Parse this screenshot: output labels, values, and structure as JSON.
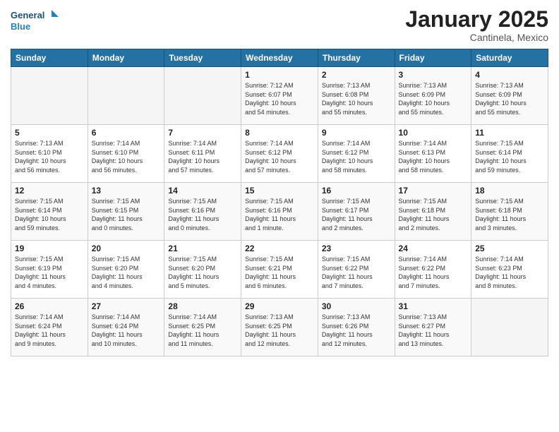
{
  "logo": {
    "line1": "General",
    "line2": "Blue"
  },
  "title": "January 2025",
  "subtitle": "Cantinela, Mexico",
  "weekdays": [
    "Sunday",
    "Monday",
    "Tuesday",
    "Wednesday",
    "Thursday",
    "Friday",
    "Saturday"
  ],
  "weeks": [
    [
      {
        "day": "",
        "info": ""
      },
      {
        "day": "",
        "info": ""
      },
      {
        "day": "",
        "info": ""
      },
      {
        "day": "1",
        "info": "Sunrise: 7:12 AM\nSunset: 6:07 PM\nDaylight: 10 hours\nand 54 minutes."
      },
      {
        "day": "2",
        "info": "Sunrise: 7:13 AM\nSunset: 6:08 PM\nDaylight: 10 hours\nand 55 minutes."
      },
      {
        "day": "3",
        "info": "Sunrise: 7:13 AM\nSunset: 6:09 PM\nDaylight: 10 hours\nand 55 minutes."
      },
      {
        "day": "4",
        "info": "Sunrise: 7:13 AM\nSunset: 6:09 PM\nDaylight: 10 hours\nand 55 minutes."
      }
    ],
    [
      {
        "day": "5",
        "info": "Sunrise: 7:13 AM\nSunset: 6:10 PM\nDaylight: 10 hours\nand 56 minutes."
      },
      {
        "day": "6",
        "info": "Sunrise: 7:14 AM\nSunset: 6:10 PM\nDaylight: 10 hours\nand 56 minutes."
      },
      {
        "day": "7",
        "info": "Sunrise: 7:14 AM\nSunset: 6:11 PM\nDaylight: 10 hours\nand 57 minutes."
      },
      {
        "day": "8",
        "info": "Sunrise: 7:14 AM\nSunset: 6:12 PM\nDaylight: 10 hours\nand 57 minutes."
      },
      {
        "day": "9",
        "info": "Sunrise: 7:14 AM\nSunset: 6:12 PM\nDaylight: 10 hours\nand 58 minutes."
      },
      {
        "day": "10",
        "info": "Sunrise: 7:14 AM\nSunset: 6:13 PM\nDaylight: 10 hours\nand 58 minutes."
      },
      {
        "day": "11",
        "info": "Sunrise: 7:15 AM\nSunset: 6:14 PM\nDaylight: 10 hours\nand 59 minutes."
      }
    ],
    [
      {
        "day": "12",
        "info": "Sunrise: 7:15 AM\nSunset: 6:14 PM\nDaylight: 10 hours\nand 59 minutes."
      },
      {
        "day": "13",
        "info": "Sunrise: 7:15 AM\nSunset: 6:15 PM\nDaylight: 11 hours\nand 0 minutes."
      },
      {
        "day": "14",
        "info": "Sunrise: 7:15 AM\nSunset: 6:16 PM\nDaylight: 11 hours\nand 0 minutes."
      },
      {
        "day": "15",
        "info": "Sunrise: 7:15 AM\nSunset: 6:16 PM\nDaylight: 11 hours\nand 1 minute."
      },
      {
        "day": "16",
        "info": "Sunrise: 7:15 AM\nSunset: 6:17 PM\nDaylight: 11 hours\nand 2 minutes."
      },
      {
        "day": "17",
        "info": "Sunrise: 7:15 AM\nSunset: 6:18 PM\nDaylight: 11 hours\nand 2 minutes."
      },
      {
        "day": "18",
        "info": "Sunrise: 7:15 AM\nSunset: 6:18 PM\nDaylight: 11 hours\nand 3 minutes."
      }
    ],
    [
      {
        "day": "19",
        "info": "Sunrise: 7:15 AM\nSunset: 6:19 PM\nDaylight: 11 hours\nand 4 minutes."
      },
      {
        "day": "20",
        "info": "Sunrise: 7:15 AM\nSunset: 6:20 PM\nDaylight: 11 hours\nand 4 minutes."
      },
      {
        "day": "21",
        "info": "Sunrise: 7:15 AM\nSunset: 6:20 PM\nDaylight: 11 hours\nand 5 minutes."
      },
      {
        "day": "22",
        "info": "Sunrise: 7:15 AM\nSunset: 6:21 PM\nDaylight: 11 hours\nand 6 minutes."
      },
      {
        "day": "23",
        "info": "Sunrise: 7:15 AM\nSunset: 6:22 PM\nDaylight: 11 hours\nand 7 minutes."
      },
      {
        "day": "24",
        "info": "Sunrise: 7:14 AM\nSunset: 6:22 PM\nDaylight: 11 hours\nand 7 minutes."
      },
      {
        "day": "25",
        "info": "Sunrise: 7:14 AM\nSunset: 6:23 PM\nDaylight: 11 hours\nand 8 minutes."
      }
    ],
    [
      {
        "day": "26",
        "info": "Sunrise: 7:14 AM\nSunset: 6:24 PM\nDaylight: 11 hours\nand 9 minutes."
      },
      {
        "day": "27",
        "info": "Sunrise: 7:14 AM\nSunset: 6:24 PM\nDaylight: 11 hours\nand 10 minutes."
      },
      {
        "day": "28",
        "info": "Sunrise: 7:14 AM\nSunset: 6:25 PM\nDaylight: 11 hours\nand 11 minutes."
      },
      {
        "day": "29",
        "info": "Sunrise: 7:13 AM\nSunset: 6:25 PM\nDaylight: 11 hours\nand 12 minutes."
      },
      {
        "day": "30",
        "info": "Sunrise: 7:13 AM\nSunset: 6:26 PM\nDaylight: 11 hours\nand 12 minutes."
      },
      {
        "day": "31",
        "info": "Sunrise: 7:13 AM\nSunset: 6:27 PM\nDaylight: 11 hours\nand 13 minutes."
      },
      {
        "day": "",
        "info": ""
      }
    ]
  ]
}
